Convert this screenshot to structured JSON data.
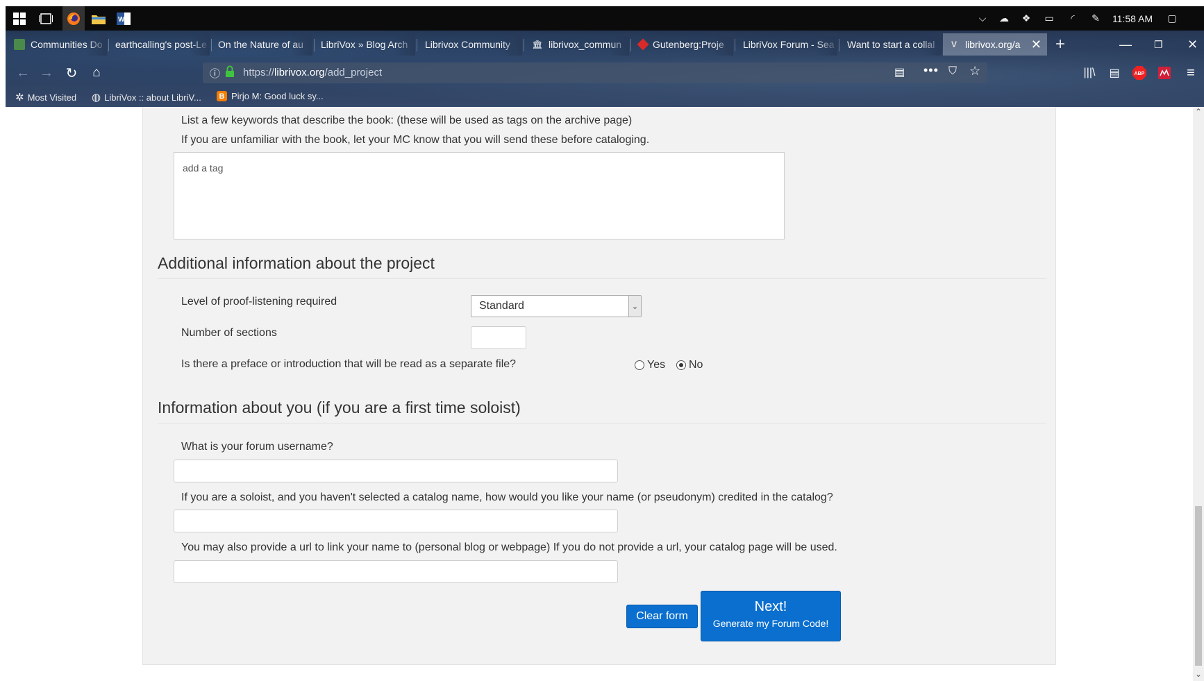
{
  "taskbar": {
    "time": "11:58 AM",
    "icons": [
      "windows-start-icon",
      "task-view-icon",
      "firefox-icon",
      "file-explorer-icon",
      "word-icon"
    ]
  },
  "tabs": [
    {
      "label": "Communities Do",
      "icon": "communities-icon"
    },
    {
      "label": "earthcalling's post-Le",
      "icon": ""
    },
    {
      "label": "On the Nature of au",
      "icon": ""
    },
    {
      "label": "LibriVox » Blog Arch",
      "icon": ""
    },
    {
      "label": "Librivox Community",
      "icon": ""
    },
    {
      "label": "librivox_commun",
      "icon": "archive-icon"
    },
    {
      "label": "Gutenberg:Proje",
      "icon": "gutenberg-icon"
    },
    {
      "label": "LibriVox Forum - Sea",
      "icon": ""
    },
    {
      "label": "Want to start a collal",
      "icon": ""
    },
    {
      "label": "librivox.org/a",
      "icon": "librivox-icon",
      "active": true
    }
  ],
  "urlbar": {
    "scheme": "https://",
    "domain": "librivox.org",
    "path": "/add_project"
  },
  "bookmarks": [
    {
      "label": "Most Visited",
      "icon": "gear-icon"
    },
    {
      "label": "LibriVox :: about LibriV...",
      "icon": "globe-icon"
    },
    {
      "label": "Pirjo M: Good luck sy...",
      "icon": "blogger-icon"
    }
  ],
  "form": {
    "keywords_instruction": "List a few keywords that describe the book: (these will be used as tags on the archive page)",
    "keywords_note": "If you are unfamiliar with the book, let your MC know that you will send these before cataloging.",
    "tag_placeholder": "add a tag",
    "section_additional": "Additional information about the project",
    "proof_label": "Level of proof-listening required",
    "proof_value": "Standard",
    "sections_label": "Number of sections",
    "sections_value": "",
    "preface_label": "Is there a preface or introduction that will be read as a separate file?",
    "preface_yes": "Yes",
    "preface_no": "No",
    "preface_selected": "No",
    "section_you": "Information about you (if you are a first time soloist)",
    "username_label": "What is your forum username?",
    "username_value": "",
    "credit_label": "If you are a soloist, and you haven't selected a catalog name, how would you like your name (or pseudonym) credited in the catalog?",
    "credit_value": "",
    "url_label": "You may also provide a url to link your name to (personal blog or webpage) If you do not provide a url, your catalog page will be used.",
    "url_value": "",
    "clear_label": "Clear form",
    "next_label": "Next!",
    "next_sublabel": "Generate my Forum Code!"
  },
  "colors": {
    "primary_button": "#0a6fcf",
    "panel_background": "#f2f2f2"
  }
}
